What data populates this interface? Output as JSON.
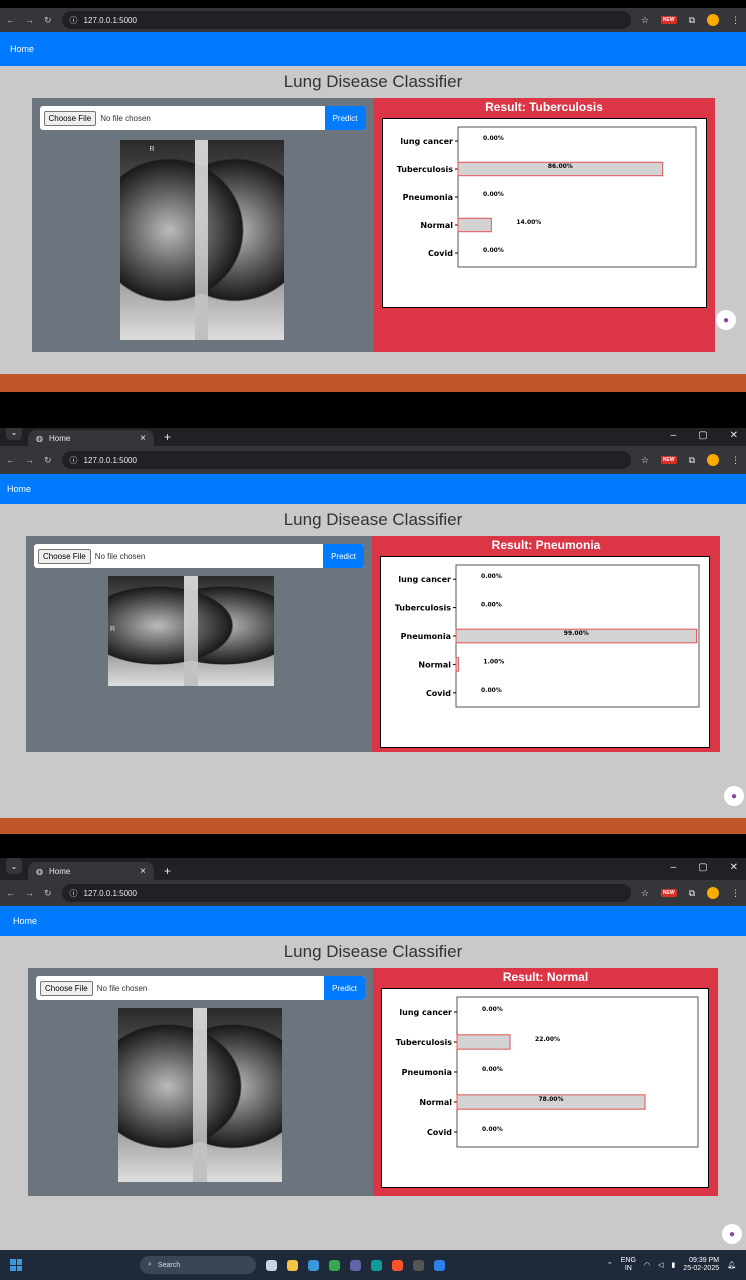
{
  "browser": {
    "tab_title": "Home",
    "url": "127.0.0.1:5000",
    "new_badge": "NEW"
  },
  "nav": {
    "home": "Home"
  },
  "page": {
    "title": "Lung Disease Classifier"
  },
  "upload": {
    "choose_label": "Choose File",
    "no_file": "No file chosen",
    "predict_label": "Predict"
  },
  "xray_marker": "R",
  "results": [
    {
      "label": "Result: Tuberculosis"
    },
    {
      "label": "Result: Pneumonia"
    },
    {
      "label": "Result: Normal"
    }
  ],
  "chart_data": [
    {
      "type": "bar",
      "orientation": "horizontal",
      "categories": [
        "lung cancer",
        "Tuberculosis",
        "Pneumonia",
        "Normal",
        "Covid"
      ],
      "values": [
        0,
        86,
        0,
        14,
        0
      ],
      "value_labels": [
        "0.00%",
        "86.00%",
        "0.00%",
        "14.00%",
        "0.00%"
      ]
    },
    {
      "type": "bar",
      "orientation": "horizontal",
      "categories": [
        "lung cancer",
        "Tuberculosis",
        "Pneumonia",
        "Normal",
        "Covid"
      ],
      "values": [
        0,
        0,
        99,
        1,
        0
      ],
      "value_labels": [
        "0.00%",
        "0.00%",
        "99.00%",
        "1.00%",
        "0.00%"
      ]
    },
    {
      "type": "bar",
      "orientation": "horizontal",
      "categories": [
        "lung cancer",
        "Tuberculosis",
        "Pneumonia",
        "Normal",
        "Covid"
      ],
      "values": [
        0,
        22,
        0,
        78,
        0
      ],
      "value_labels": [
        "0.00%",
        "22.00%",
        "0.00%",
        "78.00%",
        "0.00%"
      ]
    }
  ],
  "taskbar": {
    "search": "Search",
    "lang_top": "ENG",
    "lang_bottom": "IN",
    "time": "09:39 PM",
    "date": "25-02-2025"
  },
  "colors": {
    "nav": "#007bff",
    "result_panel": "#dc3545",
    "left_panel": "#6c757d",
    "bar_fill": "#d3d3d3",
    "bar_edge": "#e05555"
  }
}
